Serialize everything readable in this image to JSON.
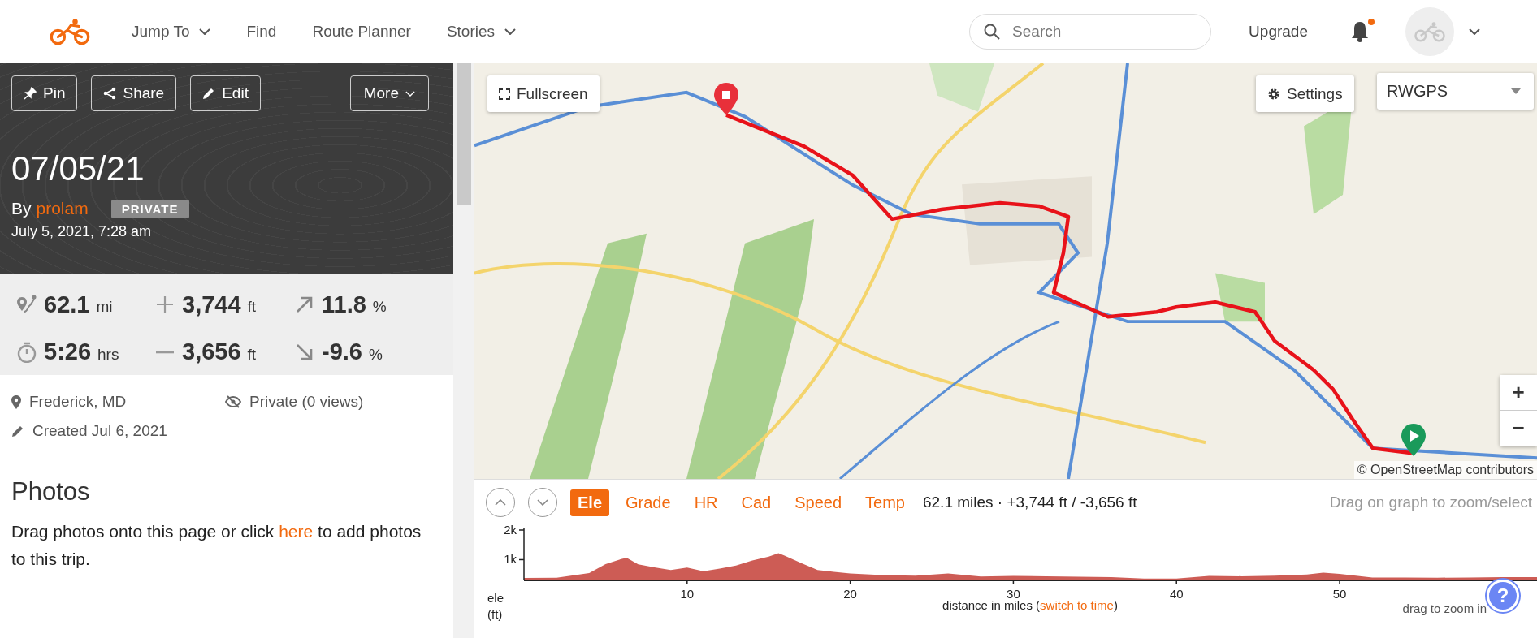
{
  "nav": {
    "items": [
      {
        "label": "Jump To",
        "dropdown": true
      },
      {
        "label": "Find",
        "dropdown": false
      },
      {
        "label": "Route Planner",
        "dropdown": false
      },
      {
        "label": "Stories",
        "dropdown": true
      }
    ],
    "search": {
      "placeholder": "Search"
    },
    "upgrade": "Upgrade",
    "notifications": {
      "unread": true
    }
  },
  "trip": {
    "actions": [
      {
        "label": "Pin",
        "kind": "pin"
      },
      {
        "label": "Share",
        "kind": "share"
      },
      {
        "label": "Edit",
        "kind": "edit"
      }
    ],
    "more": "More",
    "title": "07/05/21",
    "by": "By",
    "author": "prolam",
    "badge": "PRIVATE",
    "datetime": "July 5, 2021, 7:28 am",
    "stats": [
      {
        "kind": "distance",
        "value": "62.1",
        "unit": "mi"
      },
      {
        "kind": "gain",
        "value": "3,744",
        "unit": "ft"
      },
      {
        "kind": "grade-up",
        "value": "11.8",
        "unit": "%"
      },
      {
        "kind": "time",
        "value": "5:26",
        "unit": "hrs"
      },
      {
        "kind": "loss",
        "value": "3,656",
        "unit": "ft"
      },
      {
        "kind": "grade-down",
        "value": "-9.6",
        "unit": "%"
      }
    ],
    "details": [
      {
        "kind": "location",
        "text": "Frederick, MD"
      },
      {
        "kind": "privacy",
        "text": "Private (0 views)"
      },
      {
        "kind": "created",
        "text": "Created Jul 6, 2021"
      }
    ],
    "photos": {
      "heading": "Photos",
      "before": "Drag photos onto this page or click ",
      "link": "here",
      "after": " to add photos to this trip."
    }
  },
  "map": {
    "fullscreen": "Fullscreen",
    "settings": "Settings",
    "layer": "RWGPS",
    "zoom_in": "+",
    "zoom_out": "−",
    "attribution": "© OpenStreetMap contributors"
  },
  "graph": {
    "tabs": [
      {
        "label": "Ele",
        "selected": true
      },
      {
        "label": "Grade",
        "selected": false
      },
      {
        "label": "HR",
        "selected": false
      },
      {
        "label": "Cad",
        "selected": false
      },
      {
        "label": "Speed",
        "selected": false
      },
      {
        "label": "Temp",
        "selected": false
      }
    ],
    "summary": "62.1 miles · +3,744 ft / -3,656 ft",
    "hint": "Drag on graph to zoom/select",
    "time_switch": {
      "open": "(",
      "link": "switch to time",
      "close": ")"
    },
    "zoom_hint": "drag to zoom in",
    "help": "?",
    "chart_data": {
      "type": "area",
      "xlabel": "distance in miles",
      "ylabel": "ele (ft)",
      "x": [
        0,
        2,
        4,
        5,
        6,
        6.3,
        7,
        8,
        9,
        10,
        11,
        12,
        13,
        14,
        15,
        15.6,
        16,
        17,
        18,
        19,
        20,
        22,
        24,
        26,
        28,
        30,
        32,
        34,
        36,
        38,
        40,
        42,
        44,
        46,
        48,
        49,
        50,
        52,
        54,
        56,
        58,
        60,
        62.1
      ],
      "series": [
        {
          "color": "#cd5c55",
          "values": [
            380,
            390,
            550,
            850,
            1030,
            1060,
            840,
            740,
            650,
            730,
            610,
            700,
            800,
            970,
            1100,
            1220,
            1130,
            880,
            650,
            590,
            530,
            480,
            460,
            530,
            430,
            450,
            440,
            420,
            410,
            360,
            360,
            450,
            440,
            460,
            500,
            560,
            520,
            400,
            400,
            390,
            400,
            410,
            410
          ]
        }
      ],
      "xlim": [
        0,
        62.1
      ],
      "ylim": [
        300,
        2000
      ],
      "xticks": [
        10,
        20,
        30,
        40,
        50
      ],
      "yticks": [
        {
          "value": 1000,
          "label": "1k"
        },
        {
          "value": 2000,
          "label": "2k"
        }
      ]
    }
  }
}
